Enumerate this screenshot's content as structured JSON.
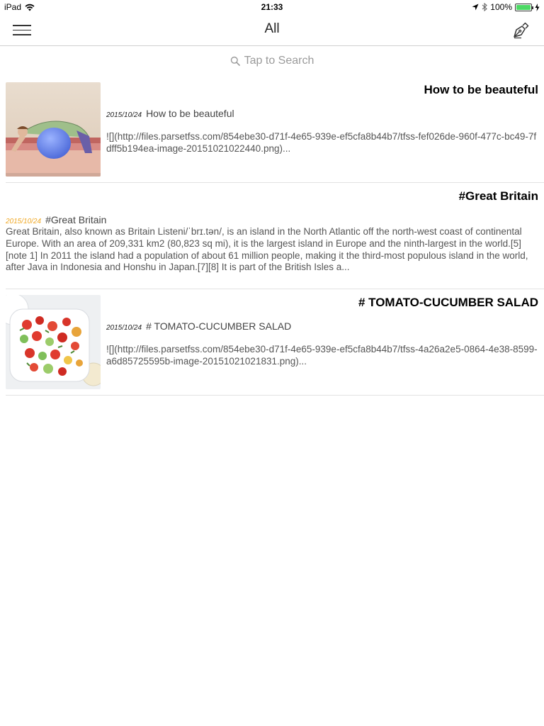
{
  "status_bar": {
    "device": "iPad",
    "time": "21:33",
    "battery": "100%",
    "battery_level": 1.0,
    "battery_color": "#4cd964"
  },
  "nav": {
    "title": "All",
    "menu_icon": "hamburger-menu-icon",
    "compose_icon": "pen-nib-icon"
  },
  "search": {
    "placeholder": "Tap to Search",
    "icon": "search-icon"
  },
  "notes": [
    {
      "title": "How to be beauteful",
      "date": "2015/10/24",
      "meta_title": "How to be beauteful",
      "excerpt": "![](http://files.parsetfss.com/854ebe30-d71f-4e65-939e-ef5cfa8b44b7/tfss-fef026de-960f-477c-bc49-7fdff5b194ea-image-20151021022440.png)...",
      "thumbnail": "yoga-ball-illustration"
    },
    {
      "title": "#Great Britain",
      "date": "2015/10/24",
      "date_color": "#f0a825",
      "meta_title": "#Great Britain",
      "excerpt": "Great Britain, also known as Britain Listeni/ˈbrɪ.tən/, is an island in the North Atlantic off the north-west coast of continental Europe. With an area of 209,331 km2 (80,823 sq mi), it is the largest island in Europe and the ninth-largest in the world.[5][note 1] In 2011 the island had a population of about 61 million people, making it the third-most populous island in the world, after Java in Indonesia and Honshu in Japan.[7][8] It is part of the British Isles a..."
    },
    {
      "title": "# TOMATO-CUCUMBER SALAD",
      "date": "2015/10/24",
      "meta_title": "# TOMATO-CUCUMBER SALAD",
      "excerpt": "![](http://files.parsetfss.com/854ebe30-d71f-4e65-939e-ef5cfa8b44b7/tfss-4a26a2e5-0864-4e38-8599-a6d85725595b-image-20151021021831.png)...",
      "thumbnail": "salad-photo"
    }
  ]
}
